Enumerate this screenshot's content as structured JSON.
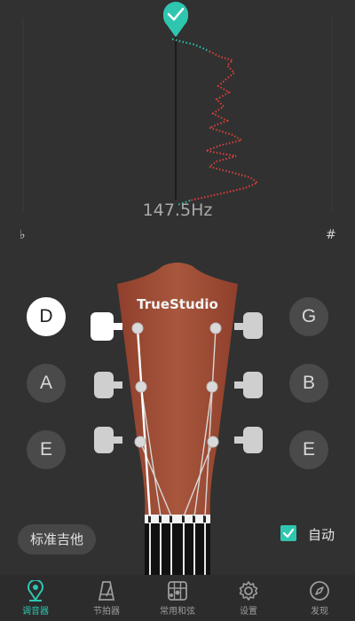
{
  "tuner": {
    "frequency": "147.5Hz",
    "flat_symbol": "♭",
    "sharp_symbol": "#",
    "in_tune": true,
    "accent_color": "#2fc6b0",
    "trace_color": "#e0413a"
  },
  "headstock": {
    "brand": "TrueStudio",
    "wood_color": "#a3513a"
  },
  "strings": {
    "left": [
      {
        "note": "D",
        "active": true
      },
      {
        "note": "A",
        "active": false
      },
      {
        "note": "E",
        "active": false
      }
    ],
    "right": [
      {
        "note": "G",
        "active": false
      },
      {
        "note": "B",
        "active": false
      },
      {
        "note": "E",
        "active": false
      }
    ]
  },
  "controls": {
    "preset_label": "标准吉他",
    "auto_label": "自动",
    "auto_checked": true
  },
  "nav": {
    "items": [
      {
        "label": "调音器",
        "icon": "tuner-pin-icon",
        "active": true
      },
      {
        "label": "节拍器",
        "icon": "metronome-icon",
        "active": false
      },
      {
        "label": "常用和弦",
        "icon": "chord-grid-icon",
        "active": false
      },
      {
        "label": "设置",
        "icon": "gear-icon",
        "active": false
      },
      {
        "label": "发现",
        "icon": "compass-icon",
        "active": false
      }
    ]
  }
}
